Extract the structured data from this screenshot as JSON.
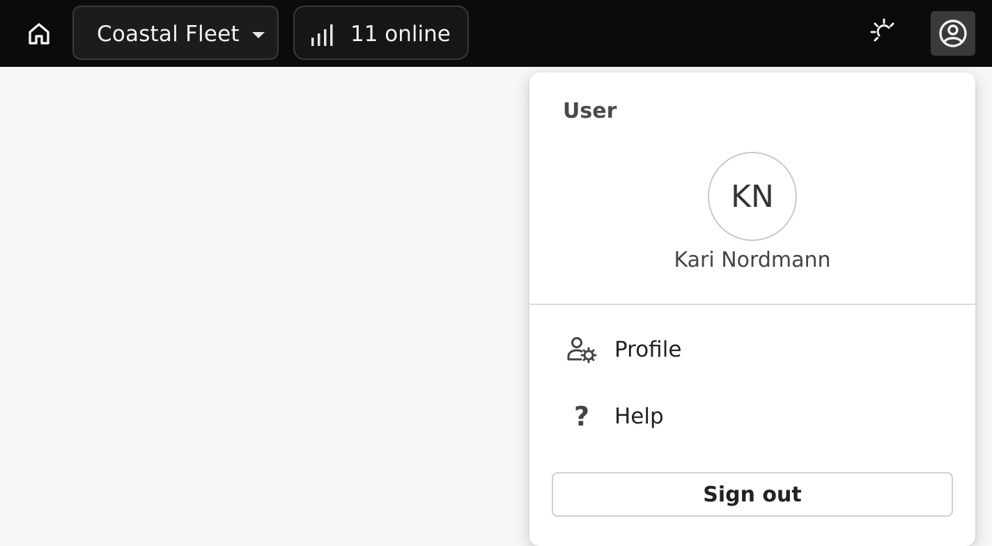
{
  "topbar": {
    "home_icon": "home-icon",
    "fleet_select": {
      "value": "Coastal Fleet",
      "caret_icon": "caret-down-icon"
    },
    "online_status": {
      "label": "11 online",
      "icon": "signal-bars-icon"
    },
    "theme_icon": "sun-moon-icon",
    "account_icon": "account-circle-icon"
  },
  "user_menu": {
    "section_title": "User",
    "avatar_initials": "KN",
    "user_name": "Kari Nordmann",
    "items": [
      {
        "label": "Profile",
        "icon": "user-settings-icon"
      },
      {
        "label": "Help",
        "icon": "question-icon"
      }
    ],
    "sign_out_label": "Sign out"
  },
  "colors": {
    "topbar_bg": "#0b0b0b",
    "page_bg": "#f7f7f7",
    "menu_bg": "#ffffff"
  }
}
